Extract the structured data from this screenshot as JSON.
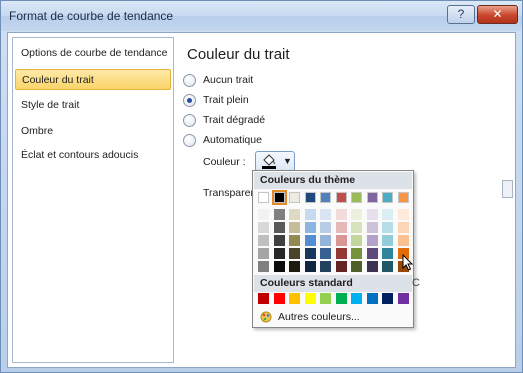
{
  "window": {
    "title": "Format de courbe de tendance",
    "help_label": "?",
    "close_label": "✕"
  },
  "nav": {
    "items": [
      {
        "label": "Options de courbe de tendance",
        "active": false
      },
      {
        "label": "Couleur du trait",
        "active": true
      },
      {
        "label": "Style de trait",
        "active": false
      },
      {
        "label": "Ombre",
        "active": false
      },
      {
        "label": "Éclat et contours adoucis",
        "active": false
      }
    ]
  },
  "content": {
    "title": "Couleur du trait",
    "options": [
      {
        "label": "Aucun trait",
        "checked": false
      },
      {
        "label": "Trait plein",
        "checked": true
      },
      {
        "label": "Trait dégradé",
        "checked": false
      },
      {
        "label": "Automatique",
        "checked": false
      }
    ],
    "color_label": "Couleur :",
    "transparency_label": "Transparen",
    "color_button_icon": "paint-bucket-icon"
  },
  "popup": {
    "theme_header": "Couleurs du thème",
    "standard_header": "Couleurs standard",
    "more_colors_label": "Autres couleurs...",
    "more_colors_icon": "color-wheel-icon",
    "theme_colors": [
      "#ffffff",
      "#000000",
      "#eeece1",
      "#1f497d",
      "#4f81bd",
      "#c0504d",
      "#9bbb59",
      "#8064a2",
      "#4bacc6",
      "#f79646"
    ],
    "theme_shades": [
      [
        "#f2f2f2",
        "#7f7f7f",
        "#ddd9c3",
        "#c6d9f0",
        "#dbe5f1",
        "#f2dcdb",
        "#ebf1dd",
        "#e5e0ec",
        "#dbeef3",
        "#fdeada"
      ],
      [
        "#d8d8d8",
        "#595959",
        "#c4bd97",
        "#8db3e2",
        "#b8cce4",
        "#e5b9b7",
        "#d7e3bc",
        "#ccc1d9",
        "#b7dde8",
        "#fbd5b5"
      ],
      [
        "#bfbfbf",
        "#3f3f3f",
        "#938953",
        "#548dd4",
        "#95b3d7",
        "#d99694",
        "#c3d69b",
        "#b2a2c7",
        "#92cddc",
        "#fac08f"
      ],
      [
        "#a5a5a5",
        "#262626",
        "#494429",
        "#17365d",
        "#366092",
        "#953734",
        "#76923c",
        "#5f497a",
        "#31859b",
        "#e36c09"
      ],
      [
        "#7f7f7f",
        "#0c0c0c",
        "#1d1b10",
        "#0f243e",
        "#244061",
        "#632423",
        "#4f6128",
        "#3f3151",
        "#205867",
        "#974806"
      ]
    ],
    "standard_colors": [
      "#c00000",
      "#ff0000",
      "#ffc000",
      "#ffff00",
      "#92d050",
      "#00b050",
      "#00b0f0",
      "#0070c0",
      "#002060",
      "#7030a0"
    ],
    "selected_theme_index": 1
  }
}
